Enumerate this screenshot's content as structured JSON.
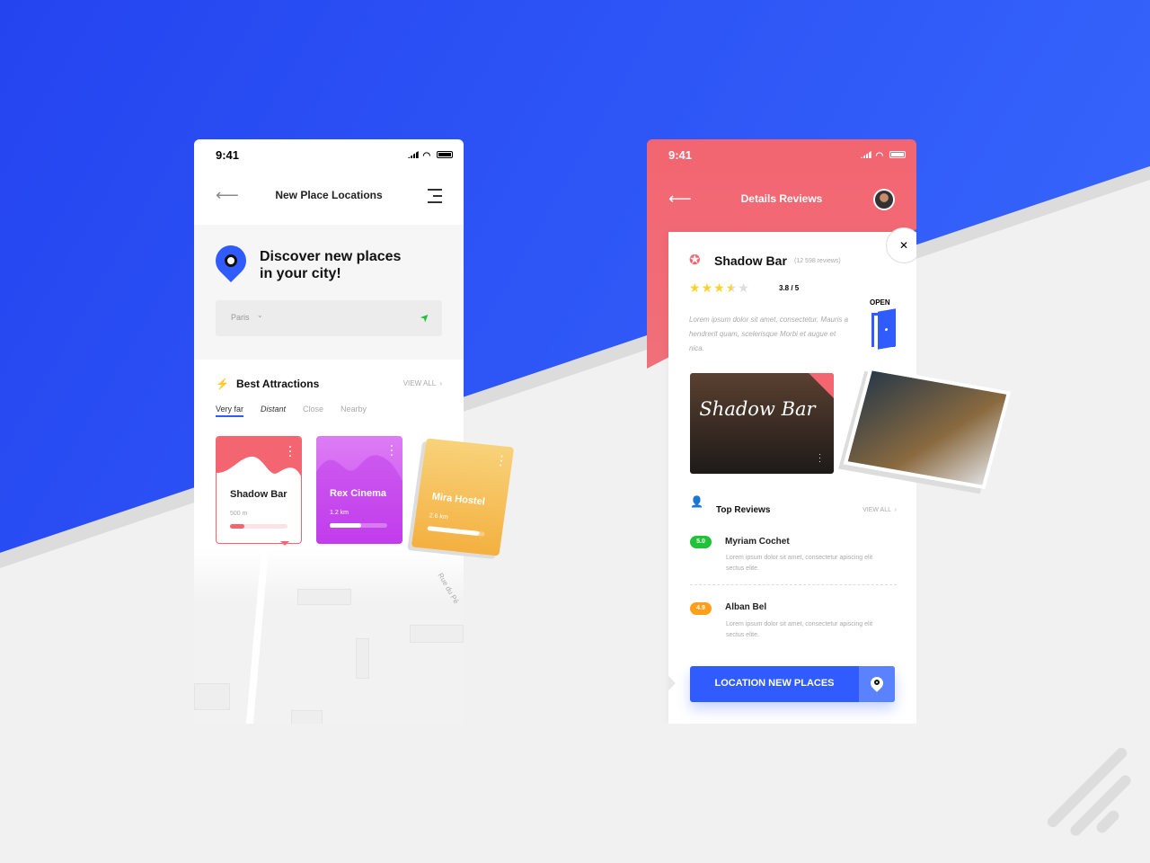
{
  "colors": {
    "blue": "#2f5bff",
    "red": "#f26571",
    "purple": "#c948f0",
    "yellow": "#f6b847",
    "green": "#22c13a",
    "orange": "#ff9f1a"
  },
  "left": {
    "time": "9:41",
    "title": "New Place Locations",
    "hero": {
      "line1": "Discover new places",
      "line2": "in your city!"
    },
    "search": {
      "value": "Paris"
    },
    "section": {
      "title": "Best Attractions",
      "view_all": "VIEW ALL"
    },
    "tabs": [
      {
        "label": "Very far",
        "active": true
      },
      {
        "label": "Distant"
      },
      {
        "label": "Close"
      },
      {
        "label": "Nearby"
      }
    ],
    "cards": [
      {
        "name": "Shadow Bar",
        "distance": "500 m",
        "progress": 0.25
      },
      {
        "name": "Rex Cinema",
        "distance": "1.2 km",
        "progress": 0.55
      },
      {
        "name": "Mira Hostel",
        "distance": "2.6 km",
        "progress": 0.9
      }
    ],
    "map": {
      "street": "Rue du Pé"
    }
  },
  "right": {
    "time": "9:41",
    "title": "Details Reviews",
    "place": {
      "name": "Shadow Bar",
      "reviews": "(12 598 reviews)",
      "rating": "3.8 / 5",
      "stars": 3.5,
      "status": "OPEN",
      "description": "Lorem ipsum dolor sit amet, consectetur. Mauris a hendrerit quam, scelerisque Morbi et augue et nica.",
      "sign": "Shadow Bar"
    },
    "reviews_section": {
      "title": "Top Reviews",
      "view_all": "VIEW ALL"
    },
    "reviews": [
      {
        "score": "5.0",
        "name": "Myriam Cochet",
        "text": "Lorem ipsum dolor sit amet, consectetur apiscing elit sectus elite.",
        "color": "#22c13a"
      },
      {
        "score": "4.9",
        "name": "Alban Bel",
        "text": "Lorem ipsum dolor sit amet, consectetur apiscing elit sectus elite.",
        "color": "#ff9f1a"
      }
    ],
    "cta": "LOCATION NEW PLACES"
  }
}
